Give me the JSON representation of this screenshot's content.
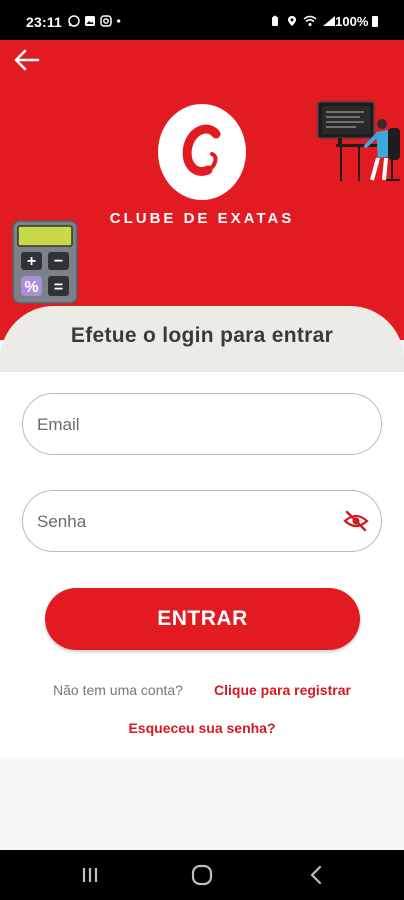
{
  "status": {
    "time": "23:11",
    "battery": "100%",
    "left_icons": [
      "whatsapp-icon",
      "gallery-icon",
      "instagram-icon",
      "dot-icon"
    ],
    "right_icons": [
      "alarm-icon",
      "location-icon",
      "wifi-icon",
      "signal-icon",
      "battery-icon"
    ]
  },
  "header": {
    "back_icon": "arrow-left-icon",
    "brand_name": "CLUBE DE EXATAS",
    "brand_color": "#e21b23"
  },
  "calculator": {
    "keys": [
      "+",
      "−",
      "%",
      "="
    ]
  },
  "login": {
    "heading": "Efetue o login para entrar",
    "email_placeholder": "Email",
    "password_placeholder": "Senha",
    "password_toggle_icon": "eye-off-icon",
    "submit_label": "ENTRAR",
    "no_account_text": "Não tem uma conta?",
    "register_link": "Clique para registrar",
    "forgot_password": "Esqueceu sua senha?"
  },
  "navbar": {
    "icons": [
      "recent-apps-icon",
      "home-icon",
      "back-icon"
    ]
  }
}
